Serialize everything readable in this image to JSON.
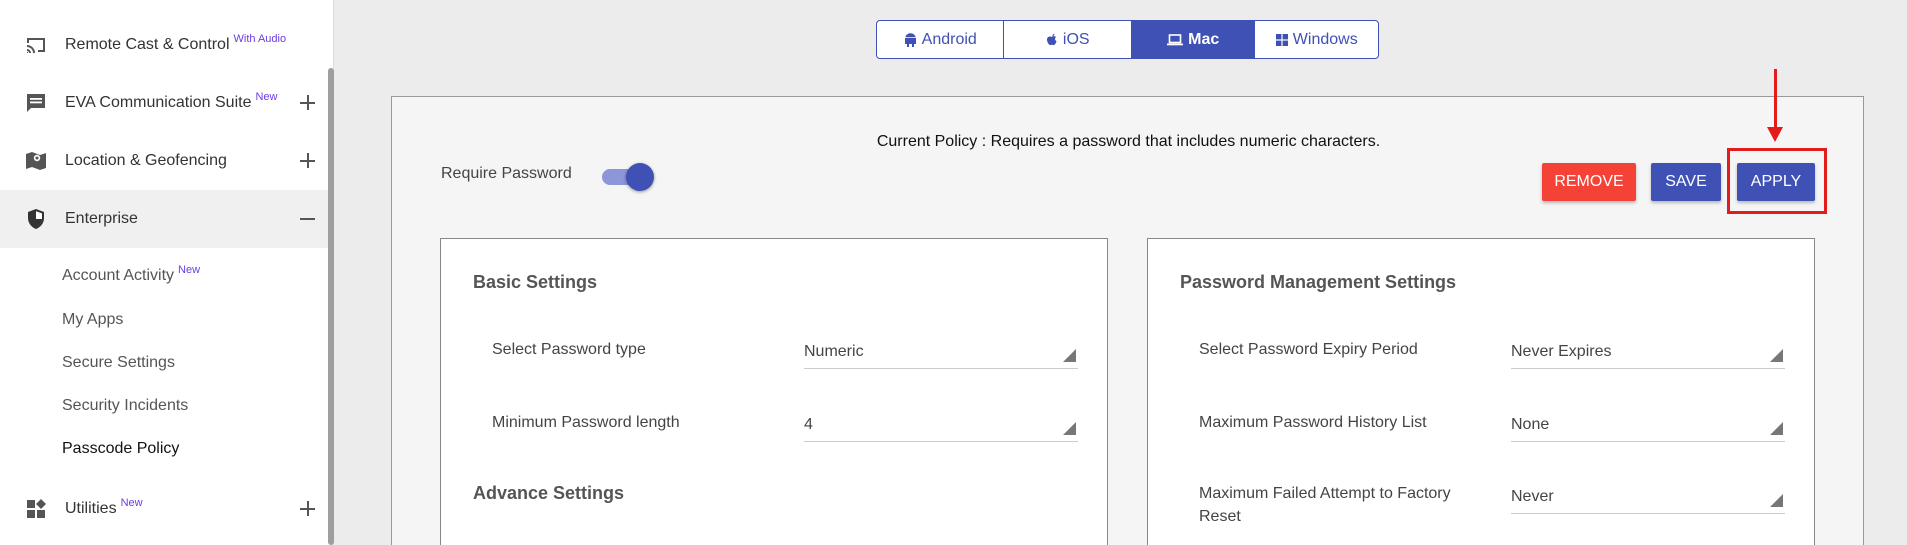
{
  "sidebar": {
    "items": [
      {
        "label": "Remote Cast & Control",
        "badge": "With Audio",
        "icon": "cast-icon"
      },
      {
        "label": "EVA Communication Suite",
        "badge": "New",
        "icon": "chat-icon"
      },
      {
        "label": "Location & Geofencing",
        "badge": "",
        "icon": "map-pin-icon"
      },
      {
        "label": "Enterprise",
        "badge": "",
        "icon": "shield-icon"
      },
      {
        "label": "Utilities",
        "badge": "New",
        "icon": "widgets-icon"
      }
    ],
    "enterprise_subitems": [
      {
        "label": "Account Activity",
        "badge": "New"
      },
      {
        "label": "My Apps",
        "badge": ""
      },
      {
        "label": "Secure Settings",
        "badge": ""
      },
      {
        "label": "Security Incidents",
        "badge": ""
      },
      {
        "label": "Passcode Policy",
        "badge": ""
      }
    ]
  },
  "os_tabs": [
    {
      "label": "Android",
      "icon": "android-icon"
    },
    {
      "label": "iOS",
      "icon": "apple-icon"
    },
    {
      "label": "Mac",
      "icon": "laptop-icon",
      "active": true
    },
    {
      "label": "Windows",
      "icon": "windows-icon"
    }
  ],
  "policy": {
    "current_policy": "Current Policy : Requires a password that includes numeric characters.",
    "require_password_label": "Require Password",
    "require_password_on": true
  },
  "actions": {
    "remove": "REMOVE",
    "save": "SAVE",
    "apply": "APPLY"
  },
  "basic_settings": {
    "title": "Basic Settings",
    "fields": [
      {
        "label": "Select Password type",
        "value": "Numeric"
      },
      {
        "label": "Minimum Password length",
        "value": "4"
      }
    ],
    "advance_title": "Advance Settings"
  },
  "password_management": {
    "title": "Password Management Settings",
    "fields": [
      {
        "label": "Select Password Expiry Period",
        "value": "Never Expires"
      },
      {
        "label": "Maximum Password History List",
        "value": "None"
      },
      {
        "label": "Maximum Failed Attempt to Factory Reset",
        "value": "Never"
      }
    ]
  },
  "colors": {
    "primary": "#3f51b5",
    "danger": "#f44336",
    "highlight": "#e21b1b",
    "badge": "#6a3ee0"
  }
}
